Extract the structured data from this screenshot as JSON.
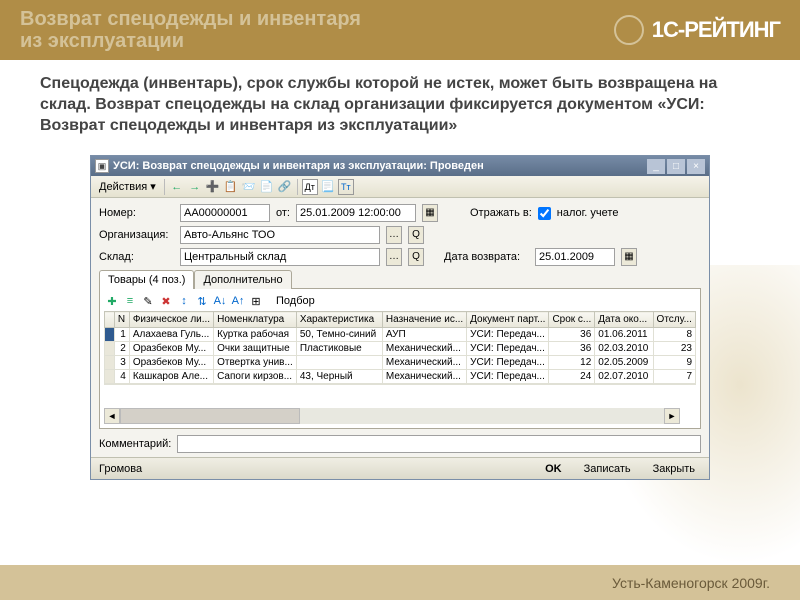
{
  "banner": {
    "title_line1": "Возврат спецодежды и инвентаря",
    "title_line2": "из эксплуатации",
    "logo_text": "1С-РЕЙТИНГ"
  },
  "description": "Спецодежда (инвентарь), срок службы которой не истек, может быть возвращена на склад. Возврат спецодежды на склад организации фиксируется документом «УСИ: Возврат спецодежды и инвентаря из эксплуатации»",
  "window": {
    "title": "УСИ: Возврат спецодежды и инвентаря из эксплуатации: Проведен",
    "menu_actions": "Действия ▾",
    "form": {
      "number_label": "Номер:",
      "number_value": "АА00000001",
      "date_label": "от:",
      "date_value": "25.01.2009 12:00:00",
      "reflect_label": "Отражать в:",
      "reflect_check": "налог. учете",
      "org_label": "Организация:",
      "org_value": "Авто-Альянс ТОО",
      "warehouse_label": "Склад:",
      "warehouse_value": "Центральный склад",
      "return_date_label": "Дата возврата:",
      "return_date_value": "25.01.2009"
    },
    "tabs": {
      "tab1": "Товары (4 поз.)",
      "tab2": "Дополнительно"
    },
    "table_toolbar": {
      "selection": "Подбор"
    },
    "table": {
      "headers": [
        "N",
        "Физическое ли...",
        "Номенклатура",
        "Характеристика",
        "Назначение ис...",
        "Документ парт...",
        "Срок с...",
        "Дата око...",
        "Отслу..."
      ],
      "rows": [
        {
          "n": "1",
          "person": "Алахаева Гуль...",
          "item": "Куртка рабочая",
          "char": "50, Темно-синий",
          "assign": "АУП",
          "doc": "УСИ: Передач...",
          "term": "36",
          "date": "01.06.2011",
          "used": "8"
        },
        {
          "n": "2",
          "person": "Оразбеков Му...",
          "item": "Очки защитные",
          "char": "Пластиковые",
          "assign": "Механический...",
          "doc": "УСИ: Передач...",
          "term": "36",
          "date": "02.03.2010",
          "used": "23"
        },
        {
          "n": "3",
          "person": "Оразбеков Му...",
          "item": "Отвертка унив...",
          "char": "",
          "assign": "Механический...",
          "doc": "УСИ: Передач...",
          "term": "12",
          "date": "02.05.2009",
          "used": "9"
        },
        {
          "n": "4",
          "person": "Кашкаров Але...",
          "item": "Сапоги кирзов...",
          "char": "43, Черный",
          "assign": "Механический...",
          "doc": "УСИ: Передач...",
          "term": "24",
          "date": "02.07.2010",
          "used": "7"
        }
      ]
    },
    "comment_label": "Комментарий:",
    "comment_value": "",
    "statusbar": {
      "user": "Громова",
      "ok": "OK",
      "save": "Записать",
      "close": "Закрыть"
    }
  },
  "footer": "Усть-Каменогорск 2009г."
}
